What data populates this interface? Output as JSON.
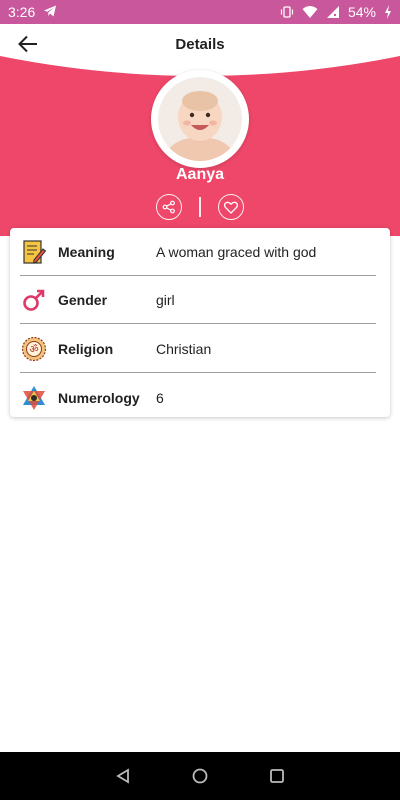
{
  "status_bar": {
    "time": "3:26",
    "battery": "54%",
    "background": "#c9579b"
  },
  "app_bar": {
    "title": "Details",
    "back_icon": "arrow-left-icon"
  },
  "profile": {
    "name": "Aanya",
    "accent": "#ee4769",
    "share_icon": "share-icon",
    "favorite_icon": "heart-icon"
  },
  "details": [
    {
      "label": "Meaning",
      "value": "A woman graced with god",
      "icon": "meaning-icon"
    },
    {
      "label": "Gender",
      "value": "girl",
      "icon": "female-symbol-icon"
    },
    {
      "label": "Religion",
      "value": "Christian",
      "icon": "om-religion-icon"
    },
    {
      "label": "Numerology",
      "value": "6",
      "icon": "star-of-david-icon"
    }
  ]
}
